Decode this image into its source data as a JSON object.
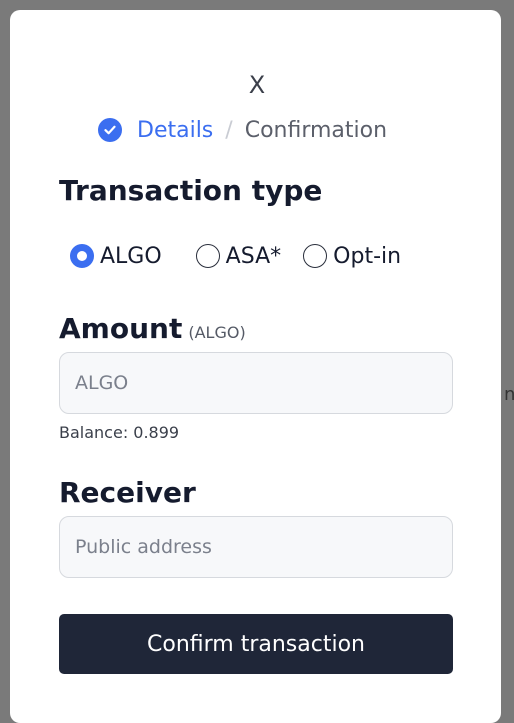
{
  "background": {
    "partial_text": "nc"
  },
  "modal": {
    "close_label": "X",
    "steps": [
      {
        "label": "Details",
        "state": "active"
      },
      {
        "label": "Confirmation",
        "state": "inactive"
      }
    ],
    "step_separator": "/",
    "transaction_type": {
      "title": "Transaction type",
      "options": [
        {
          "label": "ALGO",
          "checked": true
        },
        {
          "label": "ASA*",
          "checked": false
        },
        {
          "label": "Opt-in",
          "checked": false
        }
      ]
    },
    "amount": {
      "title": "Amount",
      "unit_hint": "(ALGO)",
      "placeholder": "ALGO",
      "value": "",
      "balance_text": "Balance: 0.899"
    },
    "receiver": {
      "title": "Receiver",
      "placeholder": "Public address",
      "value": ""
    },
    "confirm_label": "Confirm transaction"
  },
  "colors": {
    "accent": "#3b6ef0",
    "button_bg": "#1f2638",
    "overlay": "#7a7a7a"
  }
}
